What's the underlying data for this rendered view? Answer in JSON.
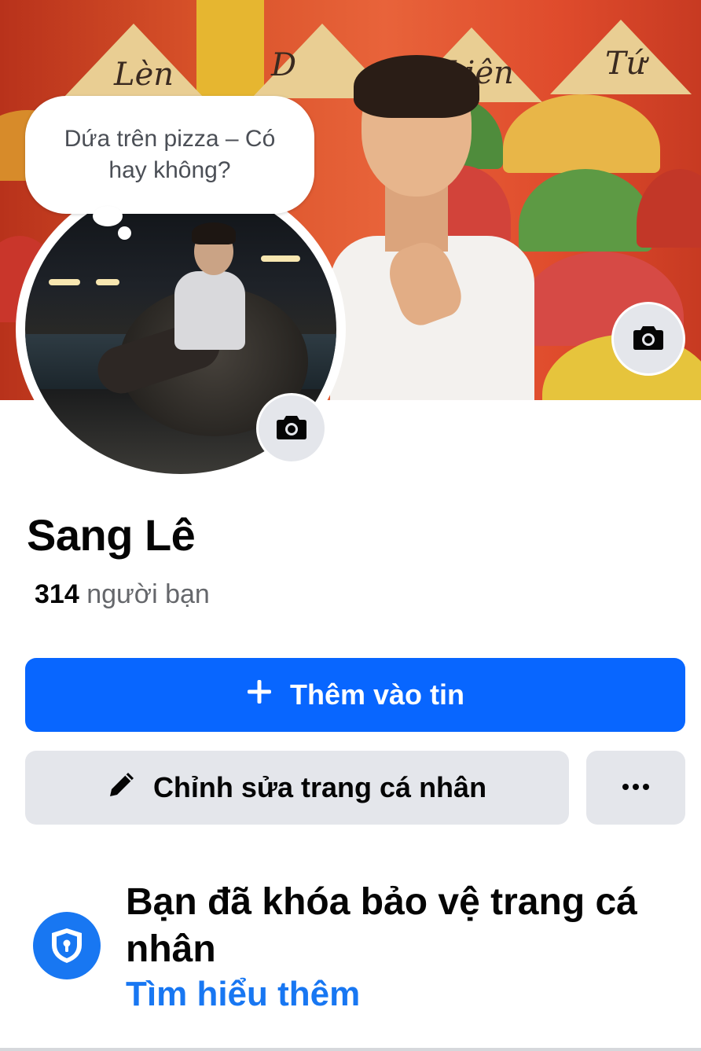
{
  "note": {
    "text": "Dứa trên pizza – Có hay không?"
  },
  "cover": {
    "hat_texts": [
      "Lèn",
      "D",
      "Liên",
      "Tứ"
    ]
  },
  "profile": {
    "name": "Sang Lê",
    "friends_count": "314",
    "friends_label": "người bạn"
  },
  "actions": {
    "add_story_label": "Thêm vào tin",
    "edit_profile_label": "Chỉnh sửa trang cá nhân",
    "more_label": "···"
  },
  "profile_lock": {
    "title": "Bạn đã khóa bảo vệ trang cá nhân",
    "link": "Tìm hiểu thêm"
  },
  "icons": {
    "camera": "camera-icon",
    "plus": "plus-icon",
    "pencil": "pencil-icon",
    "more": "more-icon",
    "shield": "shield-lock-icon"
  },
  "colors": {
    "primary": "#0866ff",
    "link": "#1877f2",
    "secondary_button": "#e4e6eb",
    "text": "#050505",
    "muted": "#65676b"
  }
}
